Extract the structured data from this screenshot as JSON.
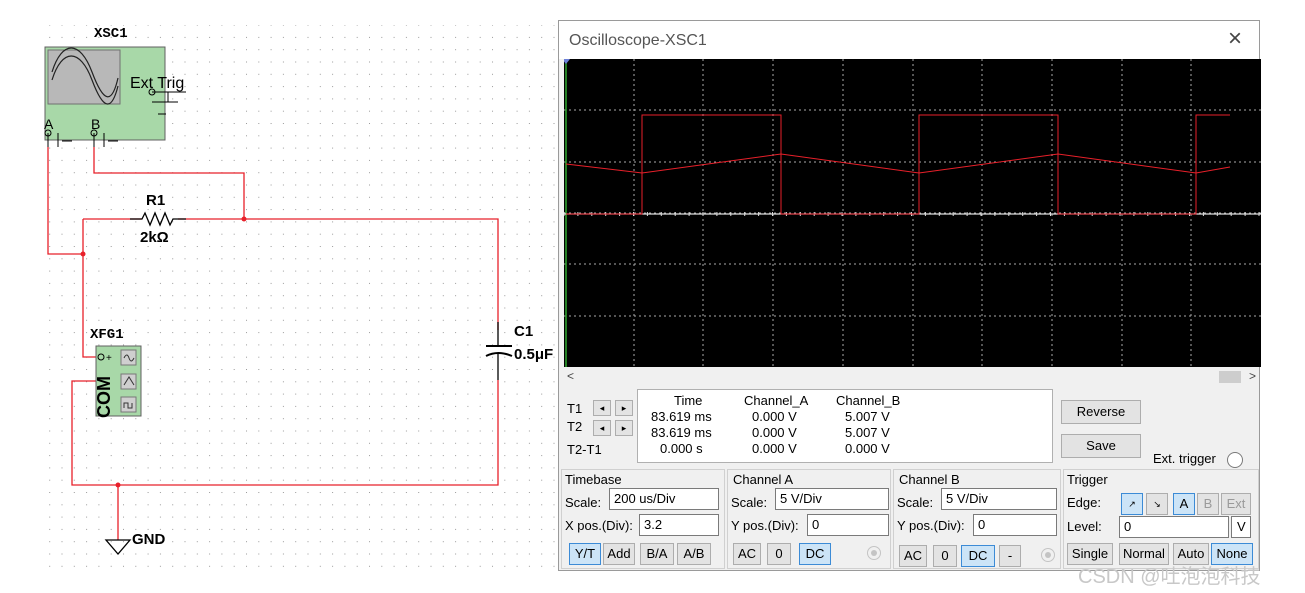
{
  "schematic": {
    "xsc1": {
      "name": "XSC1",
      "ext_trig": "Ext Trig",
      "pin_a": "A",
      "pin_b": "B"
    },
    "r1": {
      "name": "R1",
      "value": "2kΩ"
    },
    "c1": {
      "name": "C1",
      "value": "0.5μF"
    },
    "xfg1": {
      "name": "XFG1",
      "com": "COM"
    },
    "gnd": {
      "label": "GND"
    }
  },
  "oscilloscope": {
    "title": "Oscilloscope-XSC1",
    "close_glyph": "×",
    "scroll_left": "<",
    "scroll_right": ">",
    "readout": {
      "headers": [
        "Time",
        "Channel_A",
        "Channel_B"
      ],
      "rows": [
        {
          "label": "T1",
          "time": "83.619 ms",
          "a": "0.000 V",
          "b": "5.007 V"
        },
        {
          "label": "T2",
          "time": "83.619 ms",
          "a": "0.000 V",
          "b": "5.007 V"
        },
        {
          "label": "T2-T1",
          "time": "0.000 s",
          "a": "0.000 V",
          "b": "0.000 V"
        }
      ],
      "arrow_left": "◂",
      "arrow_right": "▸"
    },
    "buttons": {
      "reverse": "Reverse",
      "save": "Save",
      "ext_trigger": "Ext. trigger"
    },
    "timebase": {
      "title": "Timebase",
      "scale_label": "Scale:",
      "scale_value": "200 us/Div",
      "xpos_label": "X pos.(Div):",
      "xpos_value": "3.2",
      "modes": [
        "Y/T",
        "Add",
        "B/A",
        "A/B"
      ],
      "active_mode": "Y/T"
    },
    "channel_a": {
      "title": "Channel A",
      "scale_label": "Scale:",
      "scale_value": "5  V/Div",
      "ypos_label": "Y pos.(Div):",
      "ypos_value": "0",
      "coupling": [
        "AC",
        "0",
        "DC"
      ],
      "active": "DC"
    },
    "channel_b": {
      "title": "Channel B",
      "scale_label": "Scale:",
      "scale_value": "5  V/Div",
      "ypos_label": "Y pos.(Div):",
      "ypos_value": "0",
      "coupling": [
        "AC",
        "0",
        "DC",
        "-"
      ],
      "active": "DC"
    },
    "trigger": {
      "title": "Trigger",
      "edge_label": "Edge:",
      "level_label": "Level:",
      "level_value": "0",
      "level_unit": "V",
      "sources": [
        "A",
        "B",
        "Ext"
      ],
      "active_source": "A",
      "modes": [
        "Single",
        "Normal",
        "Auto",
        "None"
      ],
      "active_mode": "None"
    }
  },
  "colors": {
    "trace": "#e8202a",
    "wire": "#e8202a",
    "grid": "#aaaaaa",
    "screen_bg": "#000000",
    "part_green": "#a8d8a8"
  },
  "watermark": "CSDN @吐泡泡科技"
}
